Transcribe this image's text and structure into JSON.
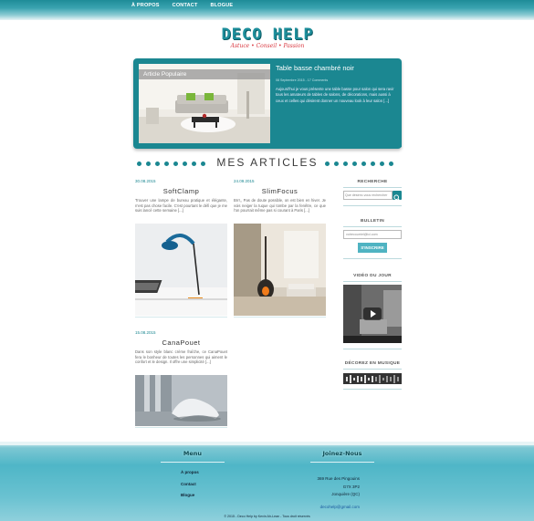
{
  "nav": {
    "items": [
      "À propos",
      "Contact",
      "Blogue"
    ]
  },
  "logo": {
    "title": "DECO HELP",
    "tagline": "Astuce • Conseil • Passion"
  },
  "featured": {
    "badge": "Article Populaire",
    "title": "Table basse chambré noir",
    "meta": "08 Septembre 2015 - 17 Comments",
    "description": "Aujourd'hui je vous présente une table basse pour salon qui sera ravir tous les amateurs de tables de salons, de décorations, mais aussi à ceux et celles qui désirent donner un nouveau look à leur salon [...]"
  },
  "section_title": "MES ARTICLES",
  "articles": [
    {
      "date": "30.08.2015",
      "title": "SoftClamp",
      "excerpt": "Trouver une lampe de bureau pratique et élégante, n'est pas chose facile. C'est pourtant le défi que je me suis lancé cette semaine [...]"
    },
    {
      "date": "24.09.2015",
      "title": "SlimFocus",
      "excerpt": "Brrr,, Pas de doute possible, on est bien en hiver. Je vois neiger la tuque qui tombe par la fenêtre, ce que l'on pourrait même pas si courant à Paris [...]"
    },
    {
      "date": "15.08.2015",
      "title": "CanaPouet",
      "excerpt": "Dans son style blanc crème fraîche, ce CanaPouet fera le bonheur de toutes les personnes qui aiment le confort et le design. Il offre une simplicité [...]"
    }
  ],
  "sidebar": {
    "search_title": "RECHERCHE",
    "search_placeholder": "Que désirez-vous rechercher",
    "newsletter_title": "BULLETIN",
    "newsletter_placeholder": "votrecourriel@ici.com",
    "newsletter_button": "S'INSCRIRE",
    "video_title": "VIDÉO DU JOUR",
    "music_title": "DÉCOREZ EN MUSIQUE"
  },
  "footer": {
    "menu_title": "Menu",
    "menu_items": [
      "À propos",
      "Contact",
      "Blogue"
    ],
    "contact_title": "Joinez-Nous",
    "address": [
      "369 Rue des Pingouins",
      "G7X 3P2",
      "Jonquière (QC)"
    ],
    "email": "decohelp@gmail.com",
    "copyright": "© 2015 - Deco Help by Kevin Ah-Lean - Tous droit réservés"
  },
  "colors": {
    "teal": "#1b8791",
    "accent_red": "#d8373f",
    "footer_blue": "#4fb6c7"
  }
}
